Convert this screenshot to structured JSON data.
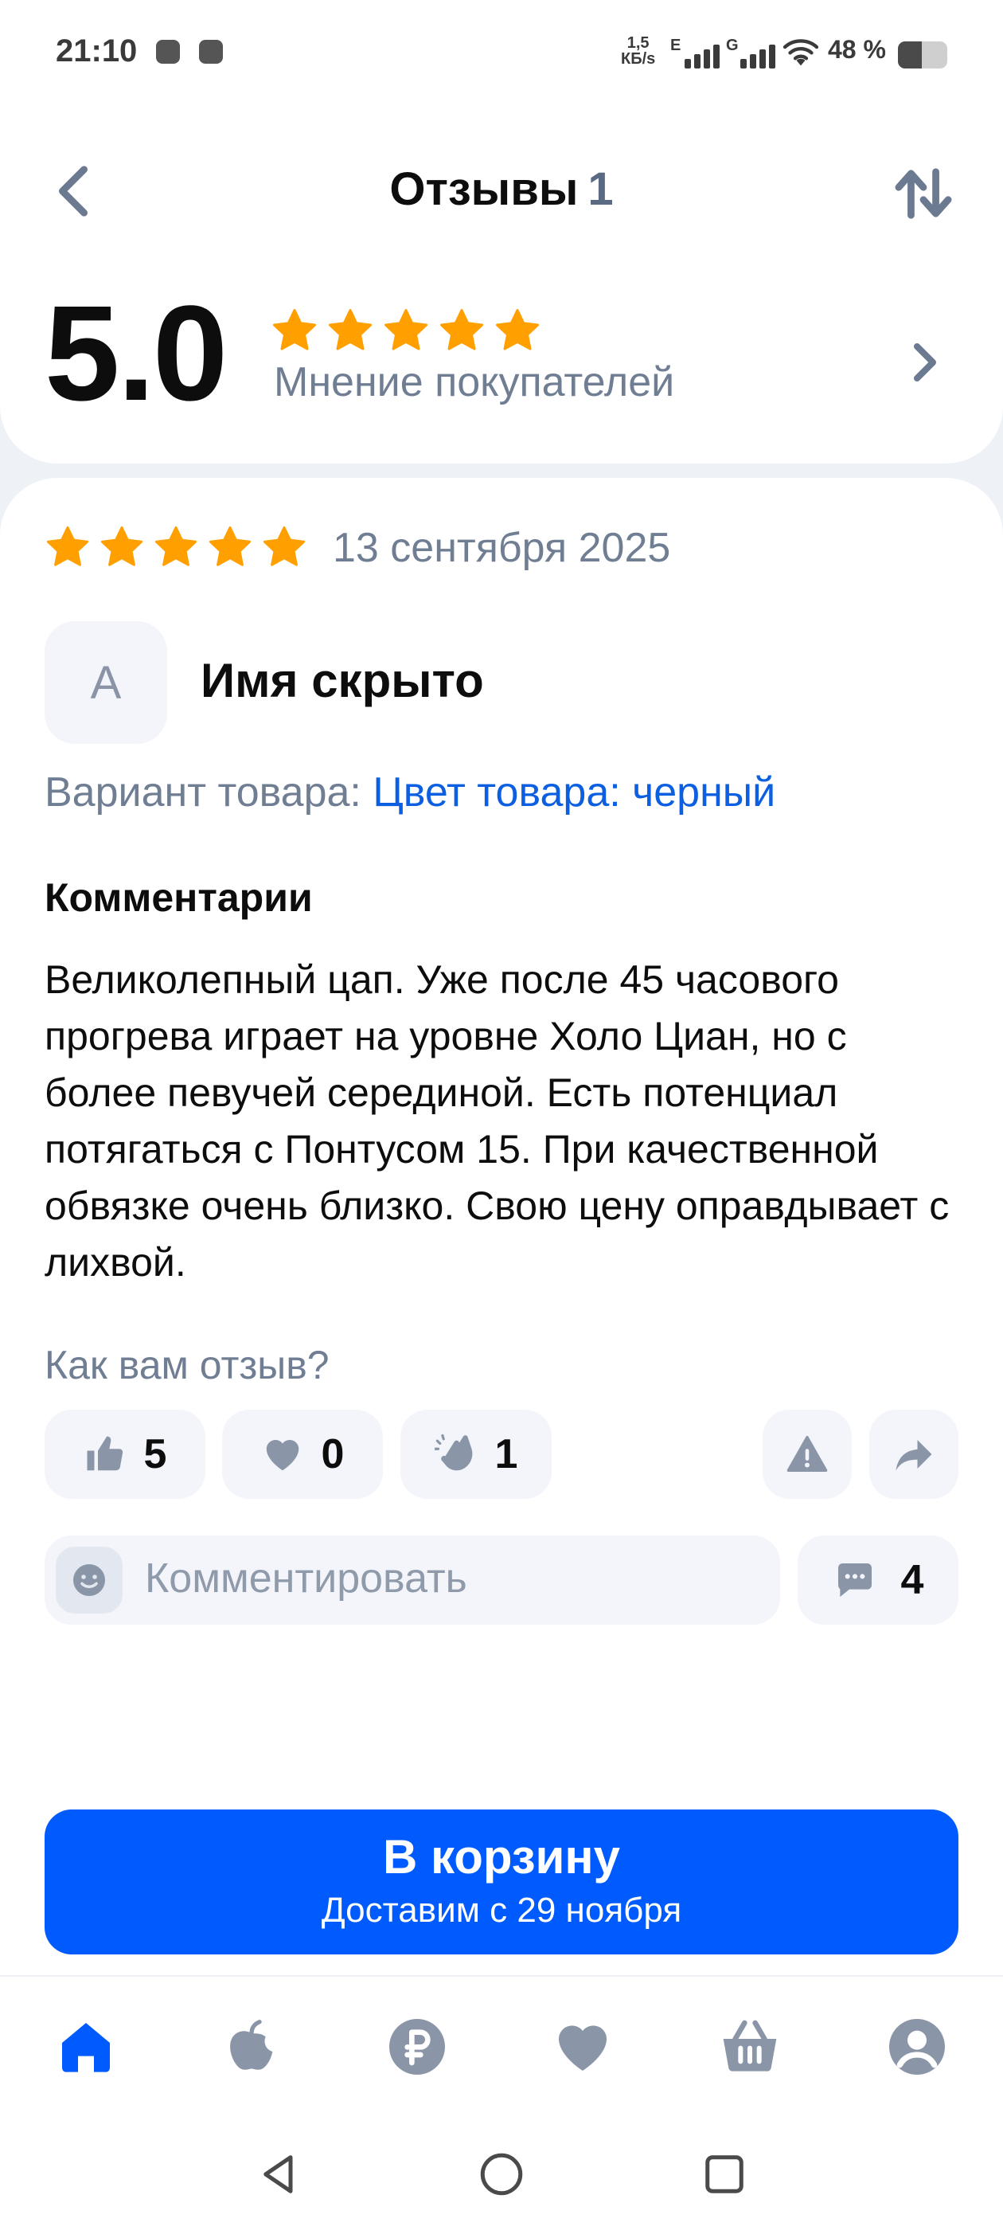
{
  "status_bar": {
    "time": "21:10",
    "net_speed_value": "1,5",
    "net_speed_unit": "КБ/s",
    "signal1_label": "E",
    "signal2_label": "G",
    "battery_text": "48 %",
    "battery_level": 0.48,
    "icons": [
      "shield-icon",
      "shield-icon",
      "signal-icon",
      "signal-icon",
      "wifi-icon",
      "battery-icon"
    ]
  },
  "header": {
    "title": "Отзывы",
    "count": "1",
    "icons": [
      "back-arrow-icon",
      "sort-icon"
    ]
  },
  "summary": {
    "rating": "5.0",
    "stars": 5,
    "label": "Мнение покупателей",
    "icon": "chevron-right-icon"
  },
  "review": {
    "stars": 5,
    "date": "13 сентября 2025",
    "avatar_letter": "А",
    "author": "Имя скрыто",
    "variant_label": "Вариант товара:",
    "variant_value": "Цвет товара: черный",
    "comments_heading": "Комментарии",
    "text": "Великолепный цап. Уже после 45 часового прогрева играет на уровне Холо Циан, но с более певучей серединой. Есть потенциал потягаться с Понтусом 15. При качественной обвязке очень близко. Свою цену оправдывает с лихвой.",
    "ask": "Как вам отзыв?",
    "reactions": {
      "like": "5",
      "heart": "0",
      "clap": "1"
    },
    "comment_placeholder": "Комментировать",
    "comment_count": "4"
  },
  "cart": {
    "title": "В корзину",
    "subtitle": "Доставим с 29 ноября"
  },
  "colors": {
    "accent": "#005bff",
    "star": "#ff9f00",
    "link": "#0b5fe0",
    "muted": "#707e93"
  },
  "bottom_nav": [
    "home-icon",
    "apple-icon",
    "ruble-icon",
    "heart-icon",
    "basket-icon",
    "profile-icon"
  ]
}
